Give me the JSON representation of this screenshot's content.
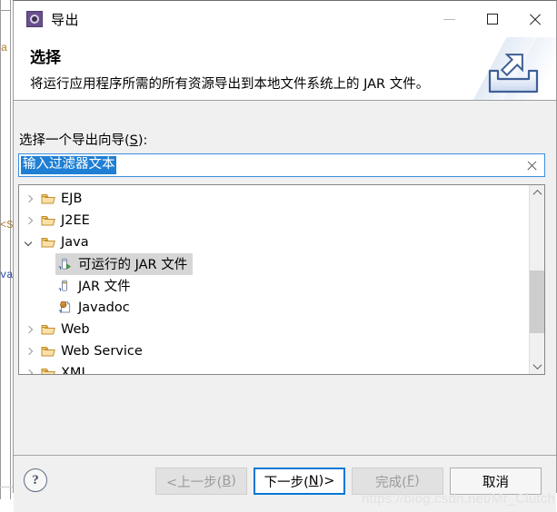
{
  "window": {
    "title": "导出",
    "app_icon": "export-wizard-icon",
    "controls": {
      "minimize": {
        "name": "minimize",
        "glyph": "—",
        "enabled": false
      },
      "maximize": {
        "name": "maximize",
        "glyph": "□",
        "enabled": true
      },
      "close": {
        "name": "close",
        "glyph": "✕",
        "enabled": true
      }
    }
  },
  "header": {
    "title": "选择",
    "description": "将运行应用程序所需的所有资源导出到本地文件系统上的 JAR 文件。",
    "banner_icon": "export-tray-arrow-icon"
  },
  "body": {
    "wizard_label_prefix": "选择一个导出向导(",
    "wizard_label_mnemonic": "S",
    "wizard_label_suffix": "):",
    "filter": {
      "value": "输入过滤器文本",
      "placeholder": "输入过滤器文本",
      "selected": true,
      "clear_icon": "clear-x-icon"
    },
    "tree": {
      "items": [
        {
          "label": "EJB",
          "icon": "folder-icon",
          "level": 0,
          "expanded": false,
          "twisty": "right",
          "selected": false
        },
        {
          "label": "J2EE",
          "icon": "folder-icon",
          "level": 0,
          "expanded": false,
          "twisty": "right",
          "selected": false
        },
        {
          "label": "Java",
          "icon": "folder-icon",
          "level": 0,
          "expanded": true,
          "twisty": "down",
          "selected": false
        },
        {
          "label": "可运行的 JAR 文件",
          "icon": "runnable-jar-icon",
          "level": 1,
          "expanded": false,
          "twisty": "none",
          "selected": true
        },
        {
          "label": "JAR 文件",
          "icon": "jar-icon",
          "level": 1,
          "expanded": false,
          "twisty": "none",
          "selected": false
        },
        {
          "label": "Javadoc",
          "icon": "javadoc-icon",
          "level": 1,
          "expanded": false,
          "twisty": "none",
          "selected": false
        },
        {
          "label": "Web",
          "icon": "folder-icon",
          "level": 0,
          "expanded": false,
          "twisty": "right",
          "selected": false
        },
        {
          "label": "Web Service",
          "icon": "folder-icon",
          "level": 0,
          "expanded": false,
          "twisty": "right",
          "selected": false
        },
        {
          "label": "XML",
          "icon": "folder-icon",
          "level": 0,
          "expanded": false,
          "twisty": "right",
          "selected": false
        }
      ],
      "scrollbar": {
        "up_icon": "scroll-up-icon",
        "down_icon": "scroll-down-icon",
        "thumb_top_percent": 44,
        "thumb_height_percent": 40
      }
    }
  },
  "footer": {
    "help_label": "?",
    "buttons": [
      {
        "name": "back",
        "label": "<上一步(B)",
        "prefix": "<上一步(",
        "mnemonic": "B",
        "suffix": ")",
        "state": "disabled"
      },
      {
        "name": "next",
        "label": "下一步(N)>",
        "prefix": "下一步(",
        "mnemonic": "N",
        "suffix": ")>",
        "state": "primary"
      },
      {
        "name": "finish",
        "label": "完成(F)",
        "prefix": "完成(",
        "mnemonic": "F",
        "suffix": ")",
        "state": "disabled"
      },
      {
        "name": "cancel",
        "label": "取消",
        "prefix": "取消",
        "mnemonic": "",
        "suffix": "",
        "state": "enabled"
      }
    ]
  },
  "watermark": {
    "text": "https://blog.csdn.net/Mr_Clutch"
  },
  "background": {
    "fragment_1": "a",
    "fragment_2": "<S",
    "fragment_3": "va"
  },
  "colors": {
    "accent": "#0078d7",
    "selection": "#1f7fd4",
    "tree_selection": "#d6d6d6",
    "panel": "#f0f0f0",
    "folder": "#e8a33d",
    "titlebar_icon": "#6a4f8f"
  }
}
